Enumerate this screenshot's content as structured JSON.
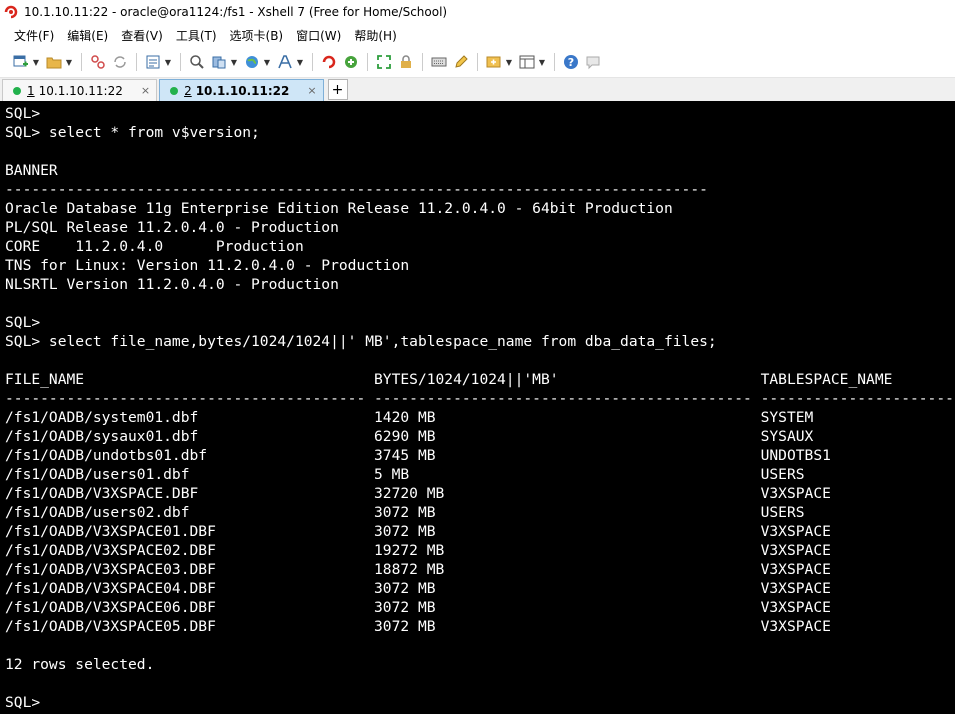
{
  "window": {
    "title": "10.1.10.11:22 - oracle@ora1124:/fs1 - Xshell 7 (Free for Home/School)"
  },
  "menu": {
    "items": [
      "文件(F)",
      "编辑(E)",
      "查看(V)",
      "工具(T)",
      "选项卡(B)",
      "窗口(W)",
      "帮助(H)"
    ]
  },
  "toolbar": {
    "icons": [
      "new-session-icon",
      "open-folder-icon",
      "disconnect-icon",
      "reconnect-icon",
      "properties-icon",
      "search-icon",
      "transfer-icon",
      "globe-icon",
      "font-icon",
      "xftp-icon",
      "xmanager-icon",
      "fullscreen-icon",
      "lock-icon",
      "keyboard-icon",
      "compose-icon",
      "add-tab-icon",
      "layout-icon",
      "help-icon",
      "chat-icon"
    ]
  },
  "tabs": [
    {
      "num": "1",
      "label": "10.1.10.11:22",
      "close": "×",
      "active": false
    },
    {
      "num": "2",
      "label": "10.1.10.11:22",
      "close": "×",
      "active": true
    }
  ],
  "tab_add": "+",
  "terminal": {
    "lines": [
      "SQL>",
      "SQL> select * from v$version;",
      "",
      "BANNER",
      "--------------------------------------------------------------------------------",
      "Oracle Database 11g Enterprise Edition Release 11.2.0.4.0 - 64bit Production",
      "PL/SQL Release 11.2.0.4.0 - Production",
      "CORE    11.2.0.4.0      Production",
      "TNS for Linux: Version 11.2.0.4.0 - Production",
      "NLSRTL Version 11.2.0.4.0 - Production",
      "",
      "SQL>",
      "SQL> select file_name,bytes/1024/1024||' MB',tablespace_name from dba_data_files;",
      "",
      "FILE_NAME                                 BYTES/1024/1024||'MB'                       TABLESPACE_NAME",
      "----------------------------------------- ------------------------------------------- ------------------------------",
      "/fs1/OADB/system01.dbf                    1420 MB                                     SYSTEM",
      "/fs1/OADB/sysaux01.dbf                    6290 MB                                     SYSAUX",
      "/fs1/OADB/undotbs01.dbf                   3745 MB                                     UNDOTBS1",
      "/fs1/OADB/users01.dbf                     5 MB                                        USERS",
      "/fs1/OADB/V3XSPACE.DBF                    32720 MB                                    V3XSPACE",
      "/fs1/OADB/users02.dbf                     3072 MB                                     USERS",
      "/fs1/OADB/V3XSPACE01.DBF                  3072 MB                                     V3XSPACE",
      "/fs1/OADB/V3XSPACE02.DBF                  19272 MB                                    V3XSPACE",
      "/fs1/OADB/V3XSPACE03.DBF                  18872 MB                                    V3XSPACE",
      "/fs1/OADB/V3XSPACE04.DBF                  3072 MB                                     V3XSPACE",
      "/fs1/OADB/V3XSPACE06.DBF                  3072 MB                                     V3XSPACE",
      "/fs1/OADB/V3XSPACE05.DBF                  3072 MB                                     V3XSPACE",
      "",
      "12 rows selected.",
      "",
      "SQL>"
    ]
  }
}
